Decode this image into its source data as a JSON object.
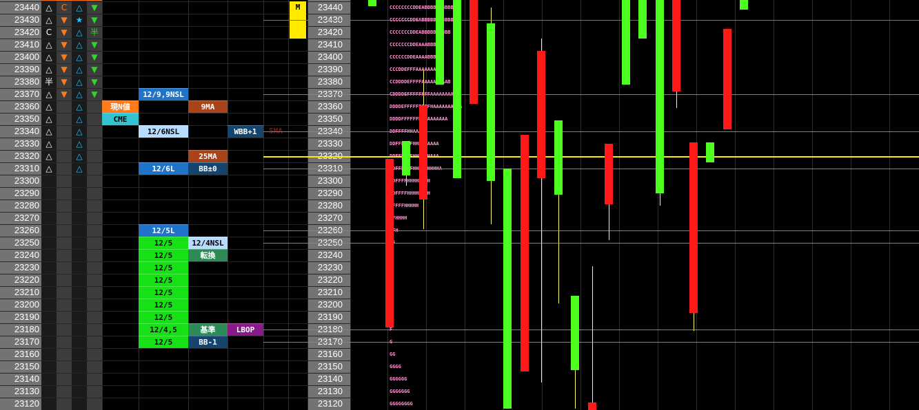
{
  "prices": [
    "23440",
    "23430",
    "23420",
    "23410",
    "23400",
    "23390",
    "23380",
    "23370",
    "23360",
    "23350",
    "23340",
    "23330",
    "23320",
    "23310",
    "23300",
    "23290",
    "23280",
    "23270",
    "23260",
    "23250",
    "23240",
    "23230",
    "23220",
    "23210",
    "23200",
    "23190",
    "23180",
    "23170",
    "23160",
    "23150",
    "23140",
    "23130",
    "23120"
  ],
  "signals": [
    {
      "row": 0,
      "col": 0,
      "icon": "triangle-outline-icon",
      "glyph": "△",
      "color": "#ffffff"
    },
    {
      "row": 0,
      "col": 1,
      "icon": "c-letter-icon",
      "glyph": "C",
      "color": "#ff7a1a"
    },
    {
      "row": 0,
      "col": 2,
      "icon": "triangle-outline-icon",
      "glyph": "△",
      "color": "#25c4ff"
    },
    {
      "row": 0,
      "col": 3,
      "icon": "triangle-down-icon",
      "glyph": "▼",
      "color": "#2dd62d"
    },
    {
      "row": 1,
      "col": 0,
      "icon": "triangle-outline-icon",
      "glyph": "△",
      "color": "#ffffff"
    },
    {
      "row": 1,
      "col": 1,
      "icon": "triangle-down-icon",
      "glyph": "▼",
      "color": "#ff7a1a"
    },
    {
      "row": 1,
      "col": 2,
      "icon": "star-icon",
      "glyph": "★",
      "color": "#25c4ff"
    },
    {
      "row": 1,
      "col": 3,
      "icon": "triangle-down-icon",
      "glyph": "▼",
      "color": "#2dd62d"
    },
    {
      "row": 2,
      "col": 0,
      "icon": "c-letter-icon",
      "glyph": "C",
      "color": "#ffffff"
    },
    {
      "row": 2,
      "col": 1,
      "icon": "triangle-down-icon",
      "glyph": "▼",
      "color": "#ff7a1a"
    },
    {
      "row": 2,
      "col": 2,
      "icon": "triangle-outline-icon",
      "glyph": "△",
      "color": "#25c4ff"
    },
    {
      "row": 2,
      "col": 3,
      "icon": "han-icon",
      "glyph": "半",
      "color": "#2dd62d"
    },
    {
      "row": 3,
      "col": 0,
      "icon": "triangle-outline-icon",
      "glyph": "△",
      "color": "#ffffff"
    },
    {
      "row": 3,
      "col": 1,
      "icon": "triangle-down-icon",
      "glyph": "▼",
      "color": "#ff7a1a"
    },
    {
      "row": 3,
      "col": 2,
      "icon": "triangle-outline-icon",
      "glyph": "△",
      "color": "#25c4ff"
    },
    {
      "row": 3,
      "col": 3,
      "icon": "triangle-down-icon",
      "glyph": "▼",
      "color": "#2dd62d"
    },
    {
      "row": 4,
      "col": 0,
      "icon": "triangle-outline-icon",
      "glyph": "△",
      "color": "#ffffff"
    },
    {
      "row": 4,
      "col": 1,
      "icon": "triangle-down-icon",
      "glyph": "▼",
      "color": "#ff7a1a"
    },
    {
      "row": 4,
      "col": 2,
      "icon": "triangle-outline-icon",
      "glyph": "△",
      "color": "#25c4ff"
    },
    {
      "row": 4,
      "col": 3,
      "icon": "triangle-down-icon",
      "glyph": "▼",
      "color": "#2dd62d"
    },
    {
      "row": 5,
      "col": 0,
      "icon": "triangle-outline-icon",
      "glyph": "△",
      "color": "#ffffff"
    },
    {
      "row": 5,
      "col": 1,
      "icon": "triangle-down-icon",
      "glyph": "▼",
      "color": "#ff7a1a"
    },
    {
      "row": 5,
      "col": 2,
      "icon": "triangle-outline-icon",
      "glyph": "△",
      "color": "#25c4ff"
    },
    {
      "row": 5,
      "col": 3,
      "icon": "triangle-down-icon",
      "glyph": "▼",
      "color": "#2dd62d"
    },
    {
      "row": 6,
      "col": 0,
      "icon": "han-icon",
      "glyph": "半",
      "color": "#ffffff"
    },
    {
      "row": 6,
      "col": 1,
      "icon": "triangle-down-icon",
      "glyph": "▼",
      "color": "#ff7a1a"
    },
    {
      "row": 6,
      "col": 2,
      "icon": "triangle-outline-icon",
      "glyph": "△",
      "color": "#25c4ff"
    },
    {
      "row": 6,
      "col": 3,
      "icon": "triangle-down-icon",
      "glyph": "▼",
      "color": "#2dd62d"
    },
    {
      "row": 7,
      "col": 0,
      "icon": "triangle-outline-icon",
      "glyph": "△",
      "color": "#ffffff"
    },
    {
      "row": 7,
      "col": 1,
      "icon": "triangle-down-icon",
      "glyph": "▼",
      "color": "#ff7a1a"
    },
    {
      "row": 7,
      "col": 2,
      "icon": "triangle-outline-icon",
      "glyph": "△",
      "color": "#25c4ff"
    },
    {
      "row": 7,
      "col": 3,
      "icon": "triangle-down-icon",
      "glyph": "▼",
      "color": "#2dd62d"
    },
    {
      "row": 8,
      "col": 0,
      "icon": "triangle-outline-icon",
      "glyph": "△",
      "color": "#ffffff"
    },
    {
      "row": 8,
      "col": 2,
      "icon": "triangle-outline-icon",
      "glyph": "△",
      "color": "#25c4ff"
    },
    {
      "row": 9,
      "col": 0,
      "icon": "triangle-outline-icon",
      "glyph": "△",
      "color": "#ffffff"
    },
    {
      "row": 9,
      "col": 2,
      "icon": "triangle-outline-icon",
      "glyph": "△",
      "color": "#25c4ff"
    },
    {
      "row": 10,
      "col": 0,
      "icon": "triangle-outline-icon",
      "glyph": "△",
      "color": "#ffffff"
    },
    {
      "row": 10,
      "col": 2,
      "icon": "triangle-outline-icon",
      "glyph": "△",
      "color": "#25c4ff"
    },
    {
      "row": 11,
      "col": 0,
      "icon": "triangle-outline-icon",
      "glyph": "△",
      "color": "#ffffff"
    },
    {
      "row": 11,
      "col": 2,
      "icon": "triangle-outline-icon",
      "glyph": "△",
      "color": "#25c4ff"
    },
    {
      "row": 12,
      "col": 0,
      "icon": "triangle-outline-icon",
      "glyph": "△",
      "color": "#ffffff"
    },
    {
      "row": 12,
      "col": 2,
      "icon": "triangle-outline-icon",
      "glyph": "△",
      "color": "#25c4ff"
    },
    {
      "row": 13,
      "col": 0,
      "icon": "triangle-outline-icon",
      "glyph": "△",
      "color": "#ffffff"
    },
    {
      "row": 13,
      "col": 2,
      "icon": "triangle-outline-icon",
      "glyph": "△",
      "color": "#25c4ff"
    }
  ],
  "labels": [
    {
      "row": 7,
      "col": "a",
      "text": "12/9,9NSL",
      "bg": "#1f73c8",
      "fg": "#ffffff"
    },
    {
      "row": 8,
      "col": "ind1",
      "text": "現N値",
      "bg": "#ff7a1a",
      "fg": "#ffffff"
    },
    {
      "row": 8,
      "col": "b",
      "text": "9MA",
      "bg": "#a8431a",
      "fg": "#ffffff"
    },
    {
      "row": 9,
      "col": "ind1",
      "text": "CME",
      "bg": "#31c3cf",
      "fg": "#000000"
    },
    {
      "row": 10,
      "col": "a",
      "text": "12/6NSL",
      "bg": "#b7dcff",
      "fg": "#000000"
    },
    {
      "row": 10,
      "col": "c",
      "text": "WBB+1",
      "bg": "#15456e",
      "fg": "#ffffff"
    },
    {
      "row": 12,
      "col": "b",
      "text": "25MA",
      "bg": "#a8431a",
      "fg": "#ffffff"
    },
    {
      "row": 13,
      "col": "a",
      "text": "12/6L",
      "bg": "#1f73c8",
      "fg": "#ffffff"
    },
    {
      "row": 13,
      "col": "b",
      "text": "BB±0",
      "bg": "#15456e",
      "fg": "#ffffff"
    },
    {
      "row": 18,
      "col": "a",
      "text": "12/5L",
      "bg": "#1f73c8",
      "fg": "#ffffff"
    },
    {
      "row": 19,
      "col": "a",
      "text": "12/5",
      "bg": "#16e016",
      "fg": "#000000"
    },
    {
      "row": 19,
      "col": "b",
      "text": "12/4NSL",
      "bg": "#b7dcff",
      "fg": "#000000"
    },
    {
      "row": 20,
      "col": "a",
      "text": "12/5",
      "bg": "#16e016",
      "fg": "#000000"
    },
    {
      "row": 20,
      "col": "b",
      "text": "転換",
      "bg": "#2e8b57",
      "fg": "#ffffff"
    },
    {
      "row": 21,
      "col": "a",
      "text": "12/5",
      "bg": "#16e016",
      "fg": "#000000"
    },
    {
      "row": 22,
      "col": "a",
      "text": "12/5",
      "bg": "#16e016",
      "fg": "#000000"
    },
    {
      "row": 23,
      "col": "a",
      "text": "12/5",
      "bg": "#16e016",
      "fg": "#000000"
    },
    {
      "row": 24,
      "col": "a",
      "text": "12/5",
      "bg": "#16e016",
      "fg": "#000000"
    },
    {
      "row": 25,
      "col": "a",
      "text": "12/5",
      "bg": "#16e016",
      "fg": "#000000"
    },
    {
      "row": 26,
      "col": "a",
      "text": "12/4,5",
      "bg": "#16e016",
      "fg": "#000000"
    },
    {
      "row": 26,
      "col": "b",
      "text": "基準",
      "bg": "#2e8b57",
      "fg": "#ffffff"
    },
    {
      "row": 26,
      "col": "c",
      "text": "LBOP",
      "bg": "#8a1a8a",
      "fg": "#ffffff"
    },
    {
      "row": 27,
      "col": "a",
      "text": "12/5",
      "bg": "#16e016",
      "fg": "#000000"
    },
    {
      "row": 27,
      "col": "b",
      "text": "BB-1",
      "bg": "#15456e",
      "fg": "#ffffff"
    },
    {
      "row": 10,
      "col": "d",
      "text": "5MA",
      "bg": "transparent",
      "fg": "#6e1a1a"
    }
  ],
  "marker": {
    "text": "M",
    "color": "#ffea00",
    "rows": [
      1,
      2
    ]
  },
  "tpo": [
    "CCCCCCCCDDEABBBBBBBBBBB",
    "CCCCCCCDDEABBBBBBBBBBB",
    "CCCCCCCDDEABBBBBBBBBB",
    "CCCCCCCDDEAAABBBB",
    "CCCCCCDDEAAAABBB",
    "CCCDDEFFFAAAAAAABB",
    "CCDDDDEFFFFAAAAAAAAAB",
    "CDDDDEFFFFFFFFAAAAAAAAAA",
    "DDDDEFFFFFFFFFHAAAAAAAAAA",
    "DDDDFFFFFFHHAAAAAAAA",
    "DDFFFFHHAAAA",
    "DDFFFFFFHHHHHAAAA",
    "DDFFFFFFHHHHHHAAA",
    "DDFFFFFFHHHHHHHHHA",
    "DDFFFFHHHHHHHH",
    "DDFFFFHHHHHHHH",
    "DFFFFHHHHH",
    "FFHHHH",
    "FFH",
    "FF",
    "F",
    "F",
    "F",
    "F",
    "F",
    "F",
    "F",
    "G",
    "GG",
    "GGGG",
    "GGGGGG",
    "GGGGGGG",
    "GGGGGGGG"
  ],
  "hlines": [
    {
      "price": "23430",
      "color": "#c23ec2"
    },
    {
      "price": "23370",
      "color": "#3a9ad9"
    },
    {
      "price": "23340",
      "color": "#3a9ad9"
    },
    {
      "price": "23320",
      "color": "#ffea00"
    },
    {
      "price": "23310",
      "color": "#3a9ad9"
    },
    {
      "price": "23260",
      "color": "#3a9ad9"
    },
    {
      "price": "23250",
      "color": "#3a9ad9"
    },
    {
      "price": "23180",
      "color": "#3a9ad9"
    },
    {
      "price": "23170",
      "color": "#3a9ad9"
    }
  ],
  "colors": {
    "up": "#4dff1f",
    "down": "#ff1a1a",
    "wick": "#ffff66"
  },
  "candles": [
    {
      "dir": "up",
      "open": 23441,
      "close": 23446,
      "high": 23446,
      "low": 23441
    },
    {
      "dir": "down",
      "open": 23318,
      "close": 23182,
      "high": 23318,
      "low": 23182
    },
    {
      "dir": "up",
      "open": 23304,
      "close": 23332,
      "high": 23330,
      "low": 23296
    },
    {
      "dir": "down",
      "open": 23361,
      "close": 23285,
      "high": 23390,
      "low": 23261
    },
    {
      "dir": "up",
      "open": 23378,
      "close": 23509,
      "high": 23509,
      "low": 23378
    },
    {
      "dir": "up",
      "open": 23302,
      "close": 23509,
      "high": 23509,
      "low": 23302
    },
    {
      "dir": "down",
      "open": 23509,
      "close": 23362,
      "high": 23509,
      "low": 23362
    },
    {
      "dir": "up",
      "open": 23300,
      "close": 23427,
      "high": 23440,
      "low": 23265
    },
    {
      "dir": "up",
      "open": 23116,
      "close": 23310,
      "high": 23310,
      "low": 23116
    },
    {
      "dir": "down",
      "open": 23337,
      "close": 23146,
      "high": 23337,
      "low": 23146
    },
    {
      "dir": "down",
      "open": 23405,
      "close": 23302,
      "high": 23415,
      "low": 23137
    },
    {
      "dir": "up",
      "open": 23289,
      "close": 23349,
      "high": 23349,
      "low": 23201
    },
    {
      "dir": "up",
      "open": 23147,
      "close": 23207,
      "high": 23207,
      "low": 23116
    },
    {
      "dir": "down",
      "open": 23121,
      "close": 23109,
      "high": 23231,
      "low": 23109
    },
    {
      "dir": "down",
      "open": 23330,
      "close": 23281,
      "high": 23330,
      "low": 23252
    },
    {
      "dir": "up",
      "open": 23378,
      "close": 23509,
      "high": 23509,
      "low": 23378
    },
    {
      "dir": "up",
      "open": 23415,
      "close": 23509,
      "high": 23509,
      "low": 23415
    },
    {
      "dir": "up",
      "open": 23290,
      "close": 23509,
      "high": 23509,
      "low": 23280
    },
    {
      "dir": "down",
      "open": 23509,
      "close": 23372,
      "high": 23509,
      "low": 23359
    },
    {
      "dir": "down",
      "open": 23331,
      "close": 23193,
      "high": 23331,
      "low": 23179
    },
    {
      "dir": "up",
      "open": 23315,
      "close": 23331,
      "high": 23331,
      "low": 23315
    },
    {
      "dir": "down",
      "open": 23423,
      "close": 23342,
      "high": 23423,
      "low": 23342
    },
    {
      "dir": "up",
      "open": 23438,
      "close": 23446,
      "high": 23446,
      "low": 23438
    }
  ]
}
